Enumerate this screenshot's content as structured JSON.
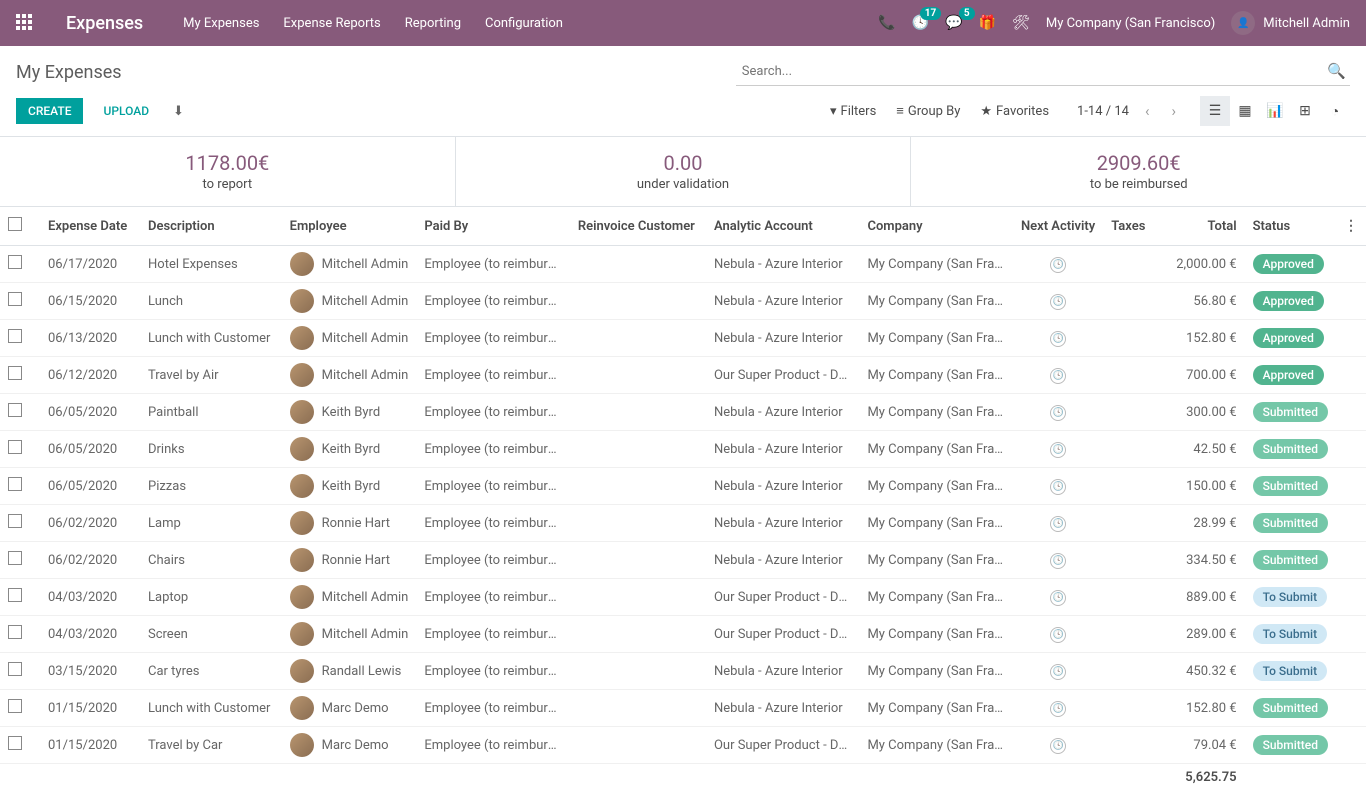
{
  "brand": "Expenses",
  "nav": [
    "My Expenses",
    "Expense Reports",
    "Reporting",
    "Configuration"
  ],
  "notifications": {
    "clock": "17",
    "chat": "5"
  },
  "company": "My Company (San Francisco)",
  "user": "Mitchell Admin",
  "page_title": "My Expenses",
  "search_placeholder": "Search...",
  "buttons": {
    "create": "CREATE",
    "upload": "UPLOAD"
  },
  "filters": {
    "filters": "Filters",
    "group_by": "Group By",
    "favorites": "Favorites"
  },
  "pager": "1-14 / 14",
  "summary": [
    {
      "value": "1178.00€",
      "label": "to report"
    },
    {
      "value": "0.00",
      "label": "under validation"
    },
    {
      "value": "2909.60€",
      "label": "to be reimbursed"
    }
  ],
  "columns": [
    "Expense Date",
    "Description",
    "Employee",
    "Paid By",
    "Reinvoice Customer",
    "Analytic Account",
    "Company",
    "Next Activity",
    "Taxes",
    "Total",
    "Status"
  ],
  "rows": [
    {
      "date": "06/17/2020",
      "desc": "Hotel Expenses",
      "emp": "Mitchell Admin",
      "paid": "Employee (to reimburse)",
      "analytic": "Nebula - Azure Interior",
      "company": "My Company (San Fran...",
      "total": "2,000.00 €",
      "status": "Approved",
      "status_class": "pill-approved"
    },
    {
      "date": "06/15/2020",
      "desc": "Lunch",
      "emp": "Mitchell Admin",
      "paid": "Employee (to reimburse)",
      "analytic": "Nebula - Azure Interior",
      "company": "My Company (San Fran...",
      "total": "56.80 €",
      "status": "Approved",
      "status_class": "pill-approved"
    },
    {
      "date": "06/13/2020",
      "desc": "Lunch with Customer",
      "emp": "Mitchell Admin",
      "paid": "Employee (to reimburse)",
      "analytic": "Nebula - Azure Interior",
      "company": "My Company (San Fran...",
      "total": "152.80 €",
      "status": "Approved",
      "status_class": "pill-approved"
    },
    {
      "date": "06/12/2020",
      "desc": "Travel by Air",
      "emp": "Mitchell Admin",
      "paid": "Employee (to reimburse)",
      "analytic": "Our Super Product - Dec...",
      "company": "My Company (San Fran...",
      "total": "700.00 €",
      "status": "Approved",
      "status_class": "pill-approved"
    },
    {
      "date": "06/05/2020",
      "desc": "Paintball",
      "emp": "Keith Byrd",
      "paid": "Employee (to reimburse)",
      "analytic": "Nebula - Azure Interior",
      "company": "My Company (San Fran...",
      "total": "300.00 €",
      "status": "Submitted",
      "status_class": "pill-submitted"
    },
    {
      "date": "06/05/2020",
      "desc": "Drinks",
      "emp": "Keith Byrd",
      "paid": "Employee (to reimburse)",
      "analytic": "Nebula - Azure Interior",
      "company": "My Company (San Fran...",
      "total": "42.50 €",
      "status": "Submitted",
      "status_class": "pill-submitted"
    },
    {
      "date": "06/05/2020",
      "desc": "Pizzas",
      "emp": "Keith Byrd",
      "paid": "Employee (to reimburse)",
      "analytic": "Nebula - Azure Interior",
      "company": "My Company (San Fran...",
      "total": "150.00 €",
      "status": "Submitted",
      "status_class": "pill-submitted"
    },
    {
      "date": "06/02/2020",
      "desc": "Lamp",
      "emp": "Ronnie Hart",
      "paid": "Employee (to reimburse)",
      "analytic": "Nebula - Azure Interior",
      "company": "My Company (San Fran...",
      "total": "28.99 €",
      "status": "Submitted",
      "status_class": "pill-submitted"
    },
    {
      "date": "06/02/2020",
      "desc": "Chairs",
      "emp": "Ronnie Hart",
      "paid": "Employee (to reimburse)",
      "analytic": "Nebula - Azure Interior",
      "company": "My Company (San Fran...",
      "total": "334.50 €",
      "status": "Submitted",
      "status_class": "pill-submitted"
    },
    {
      "date": "04/03/2020",
      "desc": "Laptop",
      "emp": "Mitchell Admin",
      "paid": "Employee (to reimburse)",
      "analytic": "Our Super Product - Dec...",
      "company": "My Company (San Fran...",
      "total": "889.00 €",
      "status": "To Submit",
      "status_class": "pill-tosubmit"
    },
    {
      "date": "04/03/2020",
      "desc": "Screen",
      "emp": "Mitchell Admin",
      "paid": "Employee (to reimburse)",
      "analytic": "Our Super Product - Dec...",
      "company": "My Company (San Fran...",
      "total": "289.00 €",
      "status": "To Submit",
      "status_class": "pill-tosubmit"
    },
    {
      "date": "03/15/2020",
      "desc": "Car tyres",
      "emp": "Randall Lewis",
      "paid": "Employee (to reimburse)",
      "analytic": "Nebula - Azure Interior",
      "company": "My Company (San Fran...",
      "total": "450.32 €",
      "status": "To Submit",
      "status_class": "pill-tosubmit"
    },
    {
      "date": "01/15/2020",
      "desc": "Lunch with Customer",
      "emp": "Marc Demo",
      "paid": "Employee (to reimburse)",
      "analytic": "Nebula - Azure Interior",
      "company": "My Company (San Fran...",
      "total": "152.80 €",
      "status": "Submitted",
      "status_class": "pill-submitted"
    },
    {
      "date": "01/15/2020",
      "desc": "Travel by Car",
      "emp": "Marc Demo",
      "paid": "Employee (to reimburse)",
      "analytic": "Our Super Product - Dec...",
      "company": "My Company (San Fran...",
      "total": "79.04 €",
      "status": "Submitted",
      "status_class": "pill-submitted"
    }
  ],
  "grand_total": "5,625.75"
}
